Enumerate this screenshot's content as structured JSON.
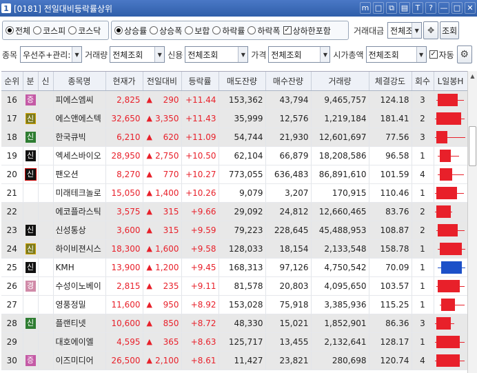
{
  "window": {
    "number": "1",
    "title": "[0181] 전일대비등락률상위",
    "controls": [
      "m",
      "□",
      "⧉",
      "▤",
      "T",
      "?",
      "—",
      "□",
      "✕"
    ]
  },
  "filters": {
    "market_options": [
      "전체",
      "코스피",
      "코스닥"
    ],
    "market_selected": 0,
    "sort_options": [
      "상승률",
      "상승폭",
      "보합",
      "하락률",
      "하락폭"
    ],
    "sort_selected": 0,
    "include_limit_label": "상하한포함",
    "include_limit_checked": true,
    "trade_amount_label": "거래대금",
    "trade_amount_value": "전체조",
    "query_button": "조회",
    "stock_label": "종목",
    "stock_value": "우선주+관리:",
    "volume_label": "거래량",
    "volume_value": "전체조회",
    "credit_label": "신용",
    "credit_value": "전체조회",
    "price_label": "가격",
    "price_value": "전체조회",
    "market_cap_label": "시가총액",
    "market_cap_value": "전체조회",
    "auto_label": "자동",
    "auto_checked": true
  },
  "table": {
    "headers": [
      "순위",
      "분",
      "신",
      "종목명",
      "현재가",
      "전일대비",
      "등락률",
      "매도잔량",
      "매수잔량",
      "거래량",
      "체결강도",
      "회수",
      "L일봉H"
    ],
    "rows": [
      {
        "rank": "16",
        "badge": "증",
        "badge_type": "b-jeung",
        "name": "피에스엠씨",
        "price": "2,825",
        "change": "290",
        "rate": "+11.44",
        "ask": "153,362",
        "bid": "43,794",
        "volume": "9,465,757",
        "strength": "124.18",
        "count": "3",
        "shade": "g",
        "candle": {
          "open": 0.1,
          "close": 0.72,
          "low": 0.05,
          "high": 0.9,
          "up": true
        }
      },
      {
        "rank": "17",
        "badge": "신",
        "badge_type": "b-sin-olive",
        "name": "에스앤에스텍",
        "price": "32,650",
        "change": "3,350",
        "rate": "+11.43",
        "ask": "35,999",
        "bid": "12,576",
        "volume": "1,219,184",
        "strength": "181.41",
        "count": "2",
        "shade": "g",
        "candle": {
          "open": 0.05,
          "close": 0.82,
          "low": 0.0,
          "high": 0.92,
          "up": true
        }
      },
      {
        "rank": "18",
        "badge": "신",
        "badge_type": "b-sin-green",
        "name": "한국큐빅",
        "price": "6,210",
        "change": "620",
        "rate": "+11.09",
        "ask": "54,744",
        "bid": "21,930",
        "volume": "12,601,697",
        "strength": "77.56",
        "count": "3",
        "shade": "g",
        "candle": {
          "open": 0.05,
          "close": 0.4,
          "low": 0.0,
          "high": 0.95,
          "up": true
        }
      },
      {
        "rank": "19",
        "badge": "신",
        "badge_type": "b-sin-black",
        "name": "엑세스바이오",
        "price": "28,950",
        "change": "2,750",
        "rate": "+10.50",
        "ask": "62,104",
        "bid": "66,879",
        "volume": "18,208,586",
        "strength": "96.58",
        "count": "1",
        "shade": "w",
        "candle": {
          "open": 0.15,
          "close": 0.5,
          "low": 0.1,
          "high": 0.75,
          "up": true
        }
      },
      {
        "rank": "20",
        "badge": "신",
        "badge_type": "b-sin-black",
        "name": "팬오션",
        "price": "8,270",
        "change": "770",
        "rate": "+10.27",
        "ask": "773,055",
        "bid": "636,483",
        "volume": "86,891,610",
        "strength": "101.59",
        "count": "4",
        "shade": "w",
        "sel": true,
        "candle": {
          "open": 0.15,
          "close": 0.55,
          "low": 0.1,
          "high": 0.9,
          "up": true
        }
      },
      {
        "rank": "21",
        "badge": "",
        "badge_type": "",
        "name": "미래테크놀로",
        "price": "15,050",
        "change": "1,400",
        "rate": "+10.26",
        "ask": "9,079",
        "bid": "3,207",
        "volume": "170,915",
        "strength": "110.46",
        "count": "1",
        "shade": "w",
        "candle": {
          "open": 0.05,
          "close": 0.7,
          "low": 0.0,
          "high": 0.9,
          "up": true
        }
      },
      {
        "rank": "22",
        "badge": "",
        "badge_type": "",
        "name": "에코플라스틱",
        "price": "3,575",
        "change": "315",
        "rate": "+9.66",
        "ask": "29,092",
        "bid": "24,812",
        "volume": "12,660,465",
        "strength": "83.76",
        "count": "2",
        "shade": "g",
        "candle": {
          "open": 0.05,
          "close": 0.5,
          "low": 0.0,
          "high": 0.55,
          "up": true
        }
      },
      {
        "rank": "23",
        "badge": "신",
        "badge_type": "b-sin-black",
        "name": "신성통상",
        "price": "3,600",
        "change": "315",
        "rate": "+9.59",
        "ask": "79,223",
        "bid": "228,645",
        "volume": "45,488,953",
        "strength": "108.87",
        "count": "2",
        "shade": "g",
        "candle": {
          "open": 0.1,
          "close": 0.72,
          "low": 0.05,
          "high": 0.92,
          "up": true
        }
      },
      {
        "rank": "24",
        "badge": "신",
        "badge_type": "b-sin-olive",
        "name": "하이비젼시스",
        "price": "18,300",
        "change": "1,600",
        "rate": "+9.58",
        "ask": "128,033",
        "bid": "18,154",
        "volume": "2,133,548",
        "strength": "158.78",
        "count": "1",
        "shade": "g",
        "candle": {
          "open": 0.15,
          "close": 0.85,
          "low": 0.1,
          "high": 0.95,
          "up": true
        }
      },
      {
        "rank": "25",
        "badge": "신",
        "badge_type": "b-sin-black",
        "name": "KMH",
        "price": "13,900",
        "change": "1,200",
        "rate": "+9.45",
        "ask": "168,313",
        "bid": "97,126",
        "volume": "4,750,542",
        "strength": "70.09",
        "count": "1",
        "shade": "w",
        "candle": {
          "open": 0.85,
          "close": 0.2,
          "low": 0.1,
          "high": 0.95,
          "up": false
        }
      },
      {
        "rank": "26",
        "badge": "경",
        "badge_type": "b-gyeong",
        "name": "수성이노베이",
        "price": "2,815",
        "change": "235",
        "rate": "+9.11",
        "ask": "81,578",
        "bid": "20,803",
        "volume": "4,095,650",
        "strength": "103.57",
        "count": "1",
        "shade": "w",
        "candle": {
          "open": 0.1,
          "close": 0.78,
          "low": 0.05,
          "high": 0.92,
          "up": true
        }
      },
      {
        "rank": "27",
        "badge": "",
        "badge_type": "",
        "name": "영풍정밀",
        "price": "11,600",
        "change": "950",
        "rate": "+8.92",
        "ask": "153,028",
        "bid": "75,918",
        "volume": "3,385,936",
        "strength": "115.25",
        "count": "1",
        "shade": "w",
        "candle": {
          "open": 0.2,
          "close": 0.62,
          "low": 0.15,
          "high": 0.92,
          "up": true
        }
      },
      {
        "rank": "28",
        "badge": "신",
        "badge_type": "b-sin-green",
        "name": "플랜티넷",
        "price": "10,600",
        "change": "850",
        "rate": "+8.72",
        "ask": "48,330",
        "bid": "15,021",
        "volume": "1,852,901",
        "strength": "86.36",
        "count": "3",
        "shade": "g",
        "candle": {
          "open": 0.05,
          "close": 0.5,
          "low": 0.0,
          "high": 0.6,
          "up": true
        }
      },
      {
        "rank": "29",
        "badge": "",
        "badge_type": "",
        "name": "대호에이엘",
        "price": "4,595",
        "change": "365",
        "rate": "+8.63",
        "ask": "125,717",
        "bid": "13,455",
        "volume": "2,132,641",
        "strength": "128.17",
        "count": "1",
        "shade": "g",
        "candle": {
          "open": 0.05,
          "close": 0.78,
          "low": 0.0,
          "high": 0.92,
          "up": true
        }
      },
      {
        "rank": "30",
        "badge": "증",
        "badge_type": "b-jeung",
        "name": "이즈미디어",
        "price": "26,500",
        "change": "2,100",
        "rate": "+8.61",
        "ask": "11,427",
        "bid": "23,821",
        "volume": "280,698",
        "strength": "120.74",
        "count": "4",
        "shade": "g",
        "candle": {
          "open": 0.05,
          "close": 0.78,
          "low": 0.0,
          "high": 0.92,
          "up": true
        }
      }
    ]
  },
  "colors": {
    "up": "#e8202a",
    "down": "#1c50c8"
  }
}
